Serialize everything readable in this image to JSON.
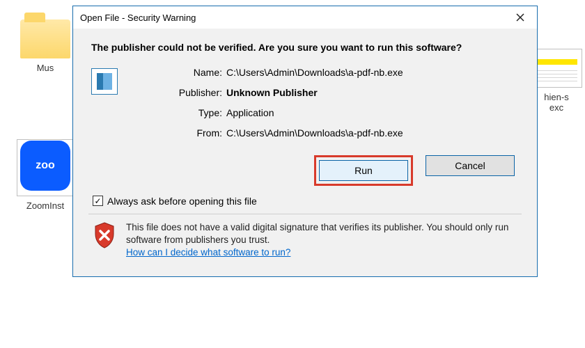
{
  "desktop": {
    "music_label": "Mus",
    "zoom_label": "ZoomInst",
    "zoom_icon_text": "zoo",
    "excel_label": "hien-s",
    "excel_label2": "exc"
  },
  "dialog": {
    "title": "Open File - Security Warning",
    "headline": "The publisher could not be verified.  Are you sure you want to run this software?",
    "labels": {
      "name": "Name:",
      "publisher": "Publisher:",
      "type": "Type:",
      "from": "From:"
    },
    "values": {
      "name": "C:\\Users\\Admin\\Downloads\\a-pdf-nb.exe",
      "publisher": "Unknown Publisher",
      "type": "Application",
      "from": "C:\\Users\\Admin\\Downloads\\a-pdf-nb.exe"
    },
    "buttons": {
      "run": "Run",
      "cancel": "Cancel"
    },
    "checkbox_label": "Always ask before opening this file",
    "footer_text": "This file does not have a valid digital signature that verifies its publisher.  You should only run software from publishers you trust.",
    "footer_link": "How can I decide what software to run?"
  }
}
